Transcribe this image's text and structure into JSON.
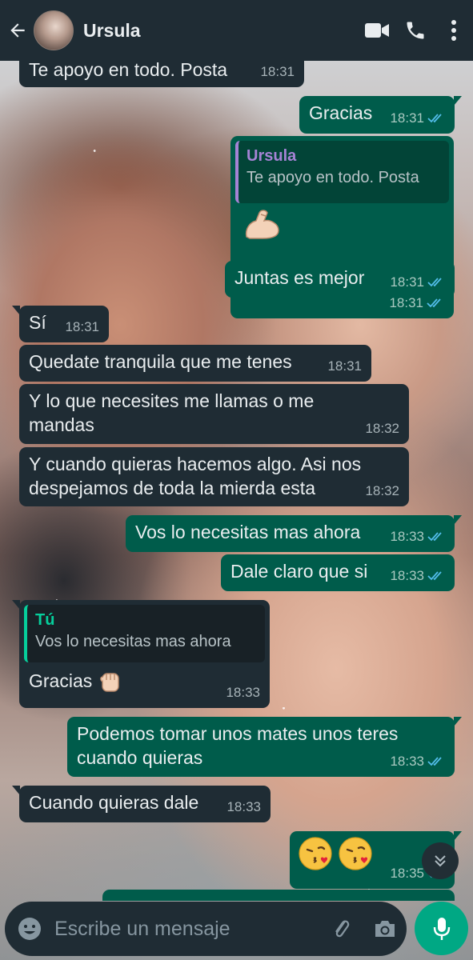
{
  "header": {
    "contact_name": "Ursula",
    "icons": [
      "back-arrow-icon",
      "video-call-icon",
      "phone-icon",
      "more-options-icon"
    ]
  },
  "colors": {
    "header_bg": "#1f2c34",
    "incoming_bubble": "#1f2c34",
    "outgoing_bubble": "#005c4b",
    "accent_green": "#00a884",
    "read_ticks": "#53bdeb",
    "quote_name_ursula": "#a583d5",
    "quote_name_you": "#06cf9c"
  },
  "messages": [
    {
      "dir": "in",
      "text": "Te apoyo en todo. Posta",
      "time": "18:31"
    },
    {
      "dir": "out",
      "text": "Gracias",
      "time": "18:31",
      "status": "read"
    },
    {
      "dir": "out",
      "quote_name": "Ursula",
      "quote_text": "Te apoyo en todo. Posta",
      "emoji": "flexed-biceps",
      "time": "18:31",
      "status": "read"
    },
    {
      "dir": "out",
      "text": "Juntas es mejor",
      "time": "18:31",
      "status": "read"
    },
    {
      "dir": "in",
      "text": "Sí",
      "time": "18:31"
    },
    {
      "dir": "in",
      "text": "Quedate tranquila que me tenes",
      "time": "18:31"
    },
    {
      "dir": "in",
      "line1": "Y lo que necesites me llamas o me",
      "line2": "mandas",
      "time": "18:32"
    },
    {
      "dir": "in",
      "line1": "Y cuando quieras hacemos algo. Asi nos",
      "line2": "despejamos de toda la mierda esta",
      "time": "18:32"
    },
    {
      "dir": "out",
      "text": "Vos lo necesitas mas ahora",
      "time": "18:33",
      "status": "read"
    },
    {
      "dir": "out",
      "text": "Dale claro que si",
      "time": "18:33",
      "status": "read"
    },
    {
      "dir": "in",
      "quote_name": "Tú",
      "quote_text": "Vos lo necesitas mas ahora",
      "text": "Gracias",
      "emoji": "raised-fist",
      "time": "18:33"
    },
    {
      "dir": "out",
      "line1": "Podemos tomar unos mates unos teres",
      "line2": "cuando quieras",
      "time": "18:33",
      "status": "read"
    },
    {
      "dir": "in",
      "text": "Cuando quieras dale",
      "time": "18:33"
    },
    {
      "dir": "out",
      "emoji": "face-blowing-a-kiss x2",
      "time": "18:35",
      "status": "read"
    }
  ],
  "composer": {
    "placeholder": "Escribe un mensaje"
  }
}
